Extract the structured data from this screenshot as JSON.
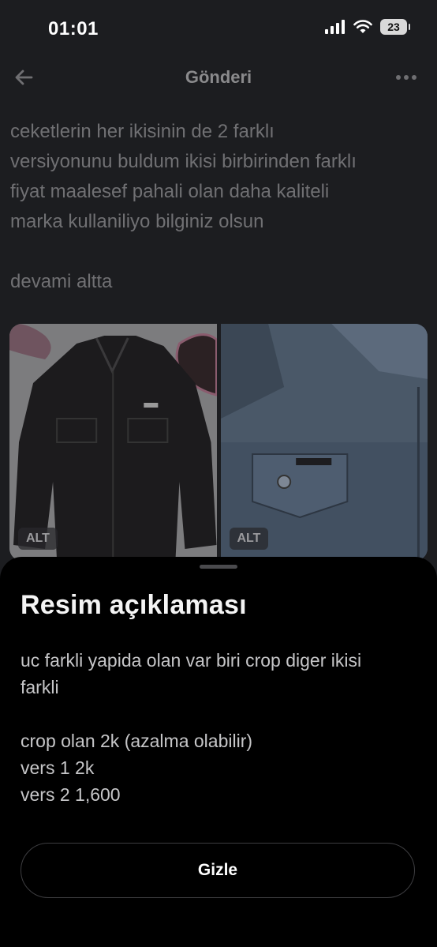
{
  "status": {
    "time": "01:01",
    "battery": "23"
  },
  "nav": {
    "title": "Gönderi"
  },
  "post": {
    "line1": "ceketlerin her ikisinin de 2 farklı",
    "line2": "versiyonunu buldum ikisi birbirinden farklı",
    "line3": "fiyat maalesef pahali olan daha kaliteli",
    "line4": "marka kullaniliyo bilginiz olsun",
    "line5": "devami altta"
  },
  "media": {
    "left_alt": "ALT",
    "right_alt": "ALT"
  },
  "sheet": {
    "title": "Resim açıklaması",
    "line1": "uc farkli yapida olan var biri crop diger ikisi",
    "line2": "farkli",
    "line3": "crop olan 2k (azalma olabilir)",
    "line4": "vers 1 2k",
    "line5": "vers 2 1,600",
    "button": "Gizle"
  },
  "colors": {
    "sheet_bg": "#000000",
    "page_bg": "#1c1d20",
    "dim_text": "#707073"
  }
}
